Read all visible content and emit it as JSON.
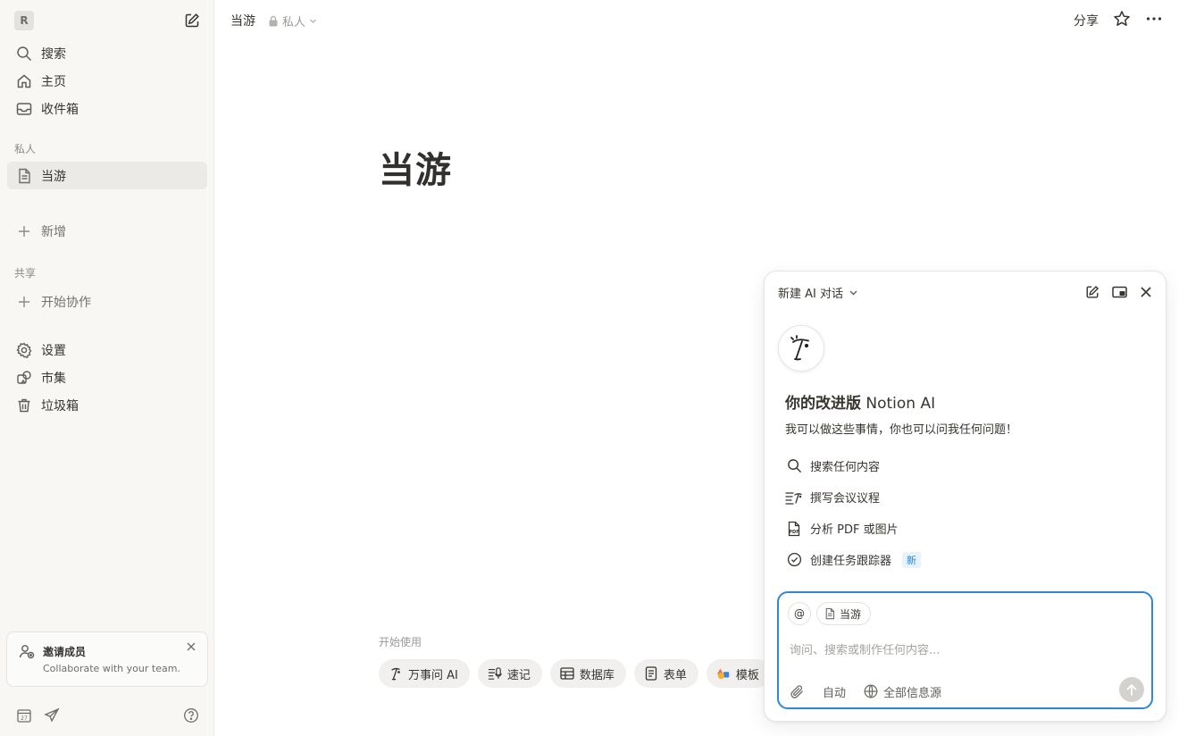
{
  "sidebar": {
    "workspace_initial": "R",
    "nav": [
      {
        "label": "搜索",
        "icon": "search-icon"
      },
      {
        "label": "主页",
        "icon": "home-icon"
      },
      {
        "label": "收件箱",
        "icon": "inbox-icon"
      }
    ],
    "private_label": "私人",
    "private_pages": [
      {
        "label": "当游",
        "icon": "page-icon"
      }
    ],
    "add_label": "新增",
    "shared_label": "共享",
    "collab_label": "开始协作",
    "bottom_nav": [
      {
        "label": "设置",
        "icon": "gear-icon"
      },
      {
        "label": "市集",
        "icon": "marketplace-icon"
      },
      {
        "label": "垃圾箱",
        "icon": "trash-icon"
      }
    ],
    "invite": {
      "title": "邀请成员",
      "subtitle": "Collaborate with your team."
    },
    "calendar_day": "27"
  },
  "topbar": {
    "page_title": "当游",
    "privacy_label": "私人",
    "share_label": "分享"
  },
  "page": {
    "title": "当游",
    "start_label": "开始使用",
    "chips": [
      {
        "label": "万事问 AI",
        "icon": "notion-ai-icon"
      },
      {
        "label": "速记",
        "icon": "notes-icon"
      },
      {
        "label": "数据库",
        "icon": "table-icon"
      },
      {
        "label": "表单",
        "icon": "form-icon"
      },
      {
        "label": "模板",
        "icon": "templates-icon"
      }
    ]
  },
  "ai_panel": {
    "header": "新建 AI 对话",
    "title_bold": "你的改进版",
    "title_rest": " Notion AI",
    "subtitle": "我可以做这些事情，你也可以问我任何问题！",
    "suggestions": [
      {
        "label": "搜索任何内容",
        "icon": "search-icon"
      },
      {
        "label": "撰写会议议程",
        "icon": "agenda-icon"
      },
      {
        "label": "分析 PDF 或图片",
        "icon": "pdf-icon"
      },
      {
        "label": "创建任务跟踪器",
        "icon": "check-circle-icon",
        "badge": "新"
      }
    ],
    "mention_symbol": "@",
    "context_page": "当游",
    "placeholder": "询问、搜索或制作任何内容...",
    "mode_label": "自动",
    "sources_label": "全部信息源",
    "accent_color": "#2e88d6"
  }
}
